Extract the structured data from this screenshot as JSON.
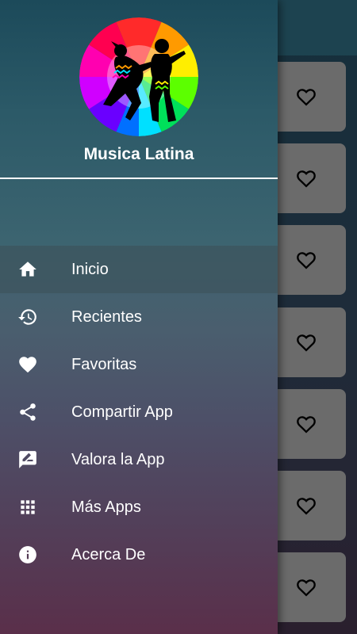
{
  "app": {
    "title": "Musica Latina"
  },
  "menu": {
    "items": [
      {
        "id": "inicio",
        "label": "Inicio",
        "icon": "home-icon",
        "active": true
      },
      {
        "id": "recientes",
        "label": "Recientes",
        "icon": "history-icon"
      },
      {
        "id": "favoritas",
        "label": "Favoritas",
        "icon": "heart-icon"
      },
      {
        "id": "compartir",
        "label": "Compartir App",
        "icon": "share-icon"
      },
      {
        "id": "valora",
        "label": "Valora la App",
        "icon": "rate-review-icon"
      },
      {
        "id": "mas_apps",
        "label": "Más Apps",
        "icon": "apps-grid-icon"
      },
      {
        "id": "acerca",
        "label": "Acerca De",
        "icon": "info-icon"
      }
    ]
  },
  "colors": {
    "accent": "#ffffff",
    "card": "#6b6b6b"
  }
}
